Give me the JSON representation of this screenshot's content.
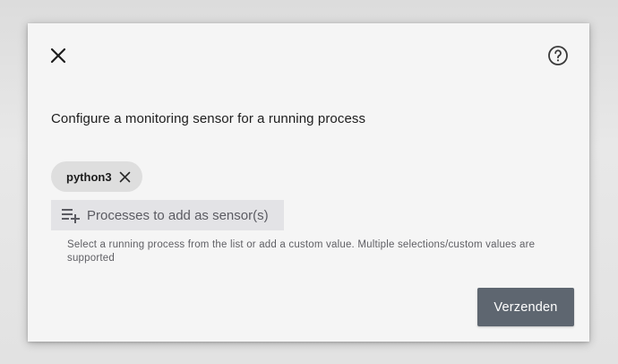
{
  "dialog": {
    "title": "Configure a monitoring sensor for a running process",
    "icons": {
      "close": "close-icon",
      "help": "help-circle-icon",
      "chip_remove": "close-icon",
      "field": "playlist-add-icon"
    },
    "chips": [
      {
        "label": "python3"
      }
    ],
    "field": {
      "placeholder": "Processes to add as sensor(s)",
      "helper": "Select a running process from the list or add a custom value. Multiple selections/custom values are supported"
    },
    "submit_label": "Verzenden"
  },
  "colors": {
    "dialog_bg": "#f5f5f5",
    "chip_bg": "#dedede",
    "field_bg": "#e3e3e6",
    "button_bg": "#5e6670",
    "button_text": "#ffffff"
  }
}
